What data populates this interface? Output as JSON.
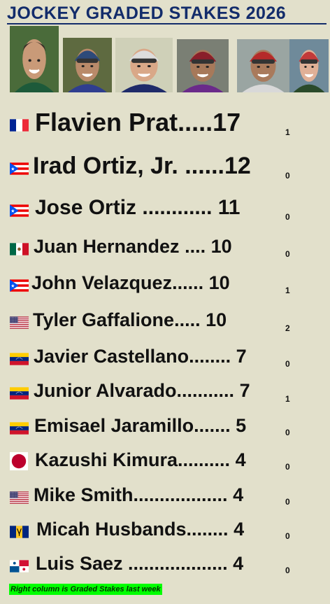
{
  "header": {
    "title": "JOCKEY GRADED STAKES 2026"
  },
  "photos": [
    {
      "name": "jockey-photo-1",
      "bg": "#4a6b3a",
      "skin": "#c99a78",
      "hair": "#3a2f28",
      "silks": "#1d5a3a",
      "helmet": ""
    },
    {
      "name": "jockey-photo-2",
      "bg": "#5e6a40",
      "skin": "#b98a6a",
      "hair": "",
      "silks": "#2f3e8f",
      "helmet": "#2d4a7a"
    },
    {
      "name": "jockey-photo-3",
      "bg": "#cfd0b8",
      "skin": "#d9a888",
      "hair": "",
      "silks": "#1f2b6a",
      "helmet": "#dcdcdc"
    },
    {
      "name": "jockey-photo-4",
      "bg": "#7a7f74",
      "skin": "#a7795a",
      "hair": "",
      "silks": "#6a2a8a",
      "helmet": "#8a1f2a"
    },
    {
      "name": "jockey-photo-5",
      "bg": "#9aa5a2",
      "skin": "#a97a5c",
      "hair": "",
      "silks": "#d8d8d8",
      "helmet": "#b52a2a"
    },
    {
      "name": "jockey-photo-6",
      "bg": "#6f8a9a",
      "skin": "#e0b097",
      "hair": "",
      "silks": "#2a4a2a",
      "helmet": "#c23a3a"
    }
  ],
  "standings": [
    {
      "flag": "france",
      "name": "Flavien Prat",
      "dots": ".....",
      "wins": "17",
      "last_week": "1"
    },
    {
      "flag": "puerto-rico",
      "name": "Irad Ortiz, Jr.",
      "dots": " ......",
      "wins": "12",
      "last_week": "0"
    },
    {
      "flag": "puerto-rico",
      "name": "Jose Ortiz",
      "dots": " ............",
      "wins": " 11",
      "last_week": "0"
    },
    {
      "flag": "mexico",
      "name": "Juan Hernandez",
      "dots": " ....",
      "wins": " 10",
      "last_week": "0"
    },
    {
      "flag": "puerto-rico",
      "name": "John Velazquez",
      "dots": "......",
      "wins": " 10",
      "last_week": "1"
    },
    {
      "flag": "usa",
      "name": "Tyler Gaffalione",
      "dots": ".....",
      "wins": " 10",
      "last_week": "2"
    },
    {
      "flag": "venezuela",
      "name": "Javier Castellano",
      "dots": "........",
      "wins": " 7",
      "last_week": "0"
    },
    {
      "flag": "venezuela",
      "name": "Junior Alvarado",
      "dots": "...........",
      "wins": " 7",
      "last_week": "1"
    },
    {
      "flag": "venezuela",
      "name": "Emisael Jaramillo",
      "dots": ".......",
      "wins": " 5",
      "last_week": "0"
    },
    {
      "flag": "japan",
      "name": "Kazushi Kimura",
      "dots": "..........",
      "wins": " 4",
      "last_week": "0"
    },
    {
      "flag": "usa",
      "name": "Mike Smith",
      "dots": "..................",
      "wins": " 4",
      "last_week": "0"
    },
    {
      "flag": "barbados",
      "name": "Micah Husbands",
      "dots": "........",
      "wins": " 4",
      "last_week": "0"
    },
    {
      "flag": "panama",
      "name": "Luis Saez",
      "dots": " ...................",
      "wins": " 4",
      "last_week": "0"
    }
  ],
  "footnote": "Right column is Graded Stakes last week",
  "colors": {
    "title": "#132c6b",
    "background": "#e2e0cb",
    "footnote_bg": "#00ff00"
  }
}
